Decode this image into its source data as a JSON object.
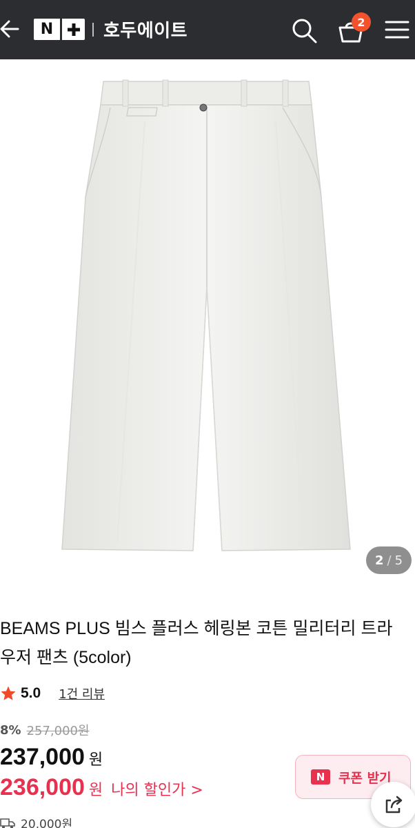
{
  "header": {
    "logo_text": "N",
    "store_name": "호두에이트",
    "cart_count": "2",
    "bg_color": "#2b2d30"
  },
  "gallery": {
    "current": "2",
    "separator": "/",
    "total": "5"
  },
  "product": {
    "title": "BEAMS PLUS 빔스 플러스 헤링본 코튼 밀리터리 트라우저 팬츠 (5color)",
    "rating": "5.0",
    "review_link": "1건 리뷰",
    "discount_rate": "8%",
    "original_price": "257,000원",
    "sale_price": "237,000",
    "sale_price_unit": "원",
    "my_price": "236,000",
    "my_price_unit": "원",
    "my_price_label": "나의 할인가 >",
    "coupon_badge": "N",
    "coupon_label": "쿠폰 받기",
    "shipping_fee": "20,000원"
  },
  "colors": {
    "accent": "#e8304f",
    "badge": "#f2522e",
    "star": "#f04a28"
  },
  "icons": [
    "back-arrow-icon",
    "search-icon",
    "cart-icon",
    "menu-icon",
    "star-icon",
    "share-icon",
    "truck-icon"
  ]
}
